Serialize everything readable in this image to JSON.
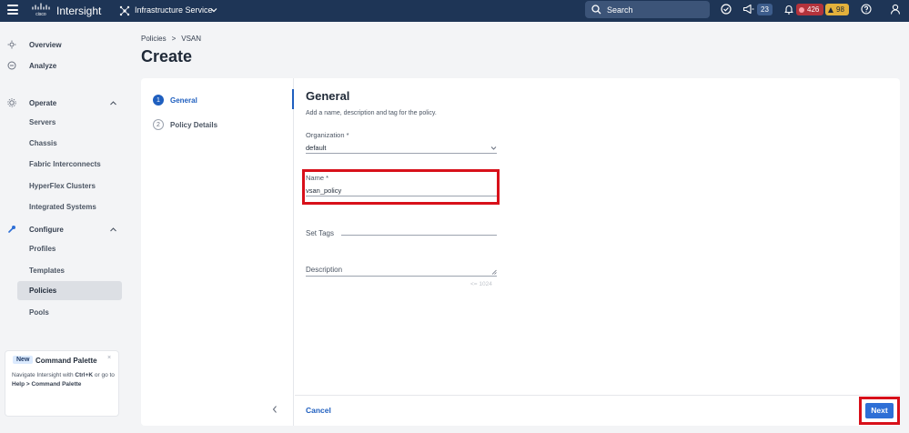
{
  "header": {
    "brand": "Intersight",
    "cisco_logo_text": "cisco",
    "service": "Infrastructure Service",
    "search_label": "Search",
    "announcements_count": "23",
    "critical_alarms": "426",
    "warning_alarms": "98",
    "icons": [
      "menu-icon",
      "cisco-logo",
      "service-icon",
      "chevron-down-icon",
      "search-icon",
      "tasks-icon",
      "megaphone-icon",
      "bell-icon",
      "help-icon",
      "user-icon"
    ]
  },
  "sidebar": {
    "overview": "Overview",
    "analyze": "Analyze",
    "operate": "Operate",
    "operate_items": [
      "Servers",
      "Chassis",
      "Fabric Interconnects",
      "HyperFlex Clusters",
      "Integrated Systems"
    ],
    "configure": "Configure",
    "configure_items": [
      "Profiles",
      "Templates",
      "Policies",
      "Pools"
    ],
    "active_item": "Policies"
  },
  "command_palette": {
    "new_badge": "New",
    "title": "Command Palette",
    "close": "×",
    "text_prefix": "Navigate Intersight with",
    "shortcut": "Ctrl+K",
    "text_middle": "or go to",
    "path": "Help > Command Palette"
  },
  "breadcrumb": {
    "items": [
      "Policies",
      "VSAN"
    ],
    "separator": ">"
  },
  "page_title": "Create",
  "steps": [
    {
      "number": "1",
      "label": "General",
      "active": true
    },
    {
      "number": "2",
      "label": "Policy Details",
      "active": false
    }
  ],
  "form": {
    "title": "General",
    "subtitle": "Add a name, description and tag for the policy.",
    "organization_label": "Organization *",
    "organization_value": "default",
    "name_label": "Name *",
    "name_value": "vsan_policy",
    "tags_label": "Set Tags",
    "description_label": "Description",
    "description_counter": "<= 1024"
  },
  "footer": {
    "cancel": "Cancel",
    "next": "Next"
  },
  "colors": {
    "topbar": "#1e3556",
    "accent": "#1f5fbf",
    "highlight": "#d8101a",
    "next_button": "#2e6fd6"
  }
}
